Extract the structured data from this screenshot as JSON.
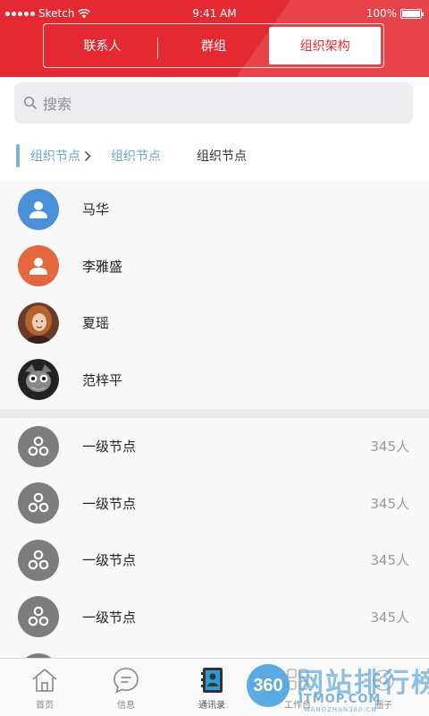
{
  "status_bar": {
    "carrier": "Sketch",
    "time": "9:41 AM",
    "battery": "100%"
  },
  "header": {
    "accent_color": "#e32a33",
    "tabs": [
      {
        "label": "联系人",
        "active": false
      },
      {
        "label": "群组",
        "active": false
      },
      {
        "label": "组织架构",
        "active": true
      }
    ]
  },
  "search": {
    "placeholder": "搜索",
    "icon": "search-icon"
  },
  "breadcrumb": {
    "items": [
      "组织节点",
      "组织节点",
      "组织节点"
    ]
  },
  "contacts": [
    {
      "name": "马华",
      "avatar": "default-user-icon",
      "avatar_color": "#4a90d9"
    },
    {
      "name": "李雅盛",
      "avatar": "default-user-icon",
      "avatar_color": "#e5673d"
    },
    {
      "name": "夏瑶",
      "avatar": "photo-avatar"
    },
    {
      "name": "范梓平",
      "avatar": "photo-avatar"
    }
  ],
  "nodes": [
    {
      "name": "一级节点",
      "count": "345人",
      "icon": "org-node-icon"
    },
    {
      "name": "一级节点",
      "count": "345人",
      "icon": "org-node-icon"
    },
    {
      "name": "一级节点",
      "count": "345人",
      "icon": "org-node-icon"
    },
    {
      "name": "一级节点",
      "count": "345人",
      "icon": "org-node-icon"
    }
  ],
  "tabbar": [
    {
      "label": "首页",
      "icon": "home-icon"
    },
    {
      "label": "信息",
      "icon": "message-icon"
    },
    {
      "label": "通讯录",
      "icon": "contacts-book-icon",
      "active": true
    },
    {
      "label": "工作台",
      "icon": "workbench-icon"
    },
    {
      "label": "圈子",
      "icon": "circle-icon"
    }
  ],
  "watermark": {
    "badge": "360",
    "title": "网站排行榜",
    "line1": "ITMOP.COM",
    "line2": "WANGZHAN360.CN"
  }
}
